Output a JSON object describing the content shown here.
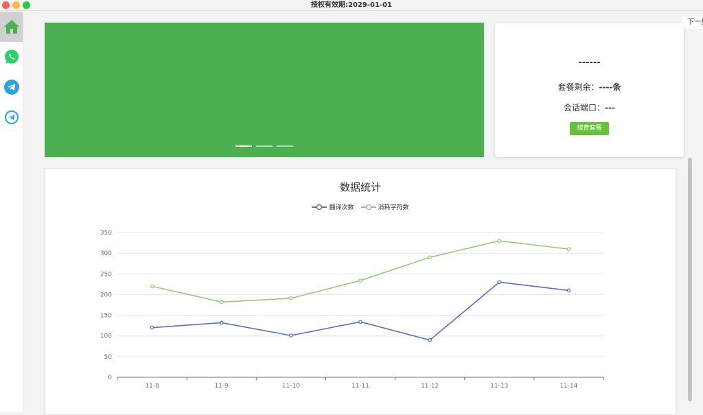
{
  "window": {
    "title": "授权有效期:2029-01-01"
  },
  "sidebar": {
    "items": [
      {
        "icon": "home-icon",
        "color": "#4caf50",
        "active": true
      },
      {
        "icon": "whatsapp-icon",
        "color": "#25d366"
      },
      {
        "icon": "telegram-icon",
        "color": "#2aa3df"
      },
      {
        "icon": "telegram-outline-icon",
        "color": "#2aa3df"
      }
    ]
  },
  "header": {
    "next_label": "下一步"
  },
  "banner": {
    "color": "#4caf50",
    "slides": 3,
    "active_slide": 0
  },
  "plan": {
    "name": "------",
    "remaining_label": "套餐剩余：",
    "remaining_value": "----条",
    "port_label": "会话端口：",
    "port_value": "---",
    "renew_label": "续费套餐"
  },
  "stats": {
    "chart_data": {
      "type": "line",
      "title": "数据统计",
      "categories": [
        "11-8",
        "11-9",
        "11-10",
        "11-11",
        "11-12",
        "11-13",
        "11-14"
      ],
      "series": [
        {
          "name": "翻译次数",
          "color": "#5470c6",
          "values": [
            120,
            132,
            101,
            134,
            90,
            230,
            210
          ]
        },
        {
          "name": "消耗字符数",
          "color": "#91cc75",
          "values": [
            220,
            182,
            191,
            234,
            290,
            330,
            310
          ]
        }
      ],
      "ylim": [
        0,
        350
      ],
      "yticks": [
        0,
        50,
        100,
        150,
        200,
        250,
        300,
        350
      ],
      "grid": true,
      "legend": "top-center"
    }
  }
}
